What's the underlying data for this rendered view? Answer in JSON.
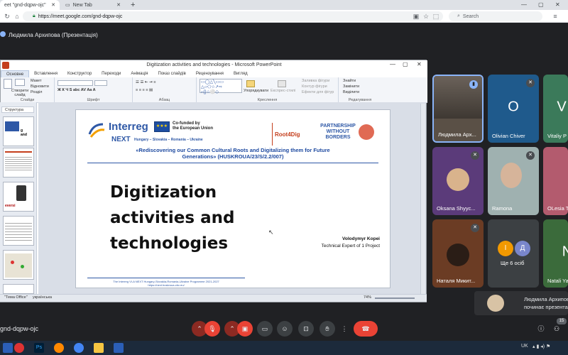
{
  "browser": {
    "tabs": [
      {
        "label": "eet \"gnd-dqpw-ojc\""
      },
      {
        "label": "New Tab"
      }
    ],
    "url": "https://meet.google.com/gnd-dqpw-ojc",
    "search_placeholder": "Search"
  },
  "meet": {
    "presenter_label": "Людмила Архипова (Презентація)",
    "meeting_code": "gnd-dqpw-ojc",
    "participant_count": "15"
  },
  "ppt": {
    "window_title": "Digitization activities and technologies  -  Microsoft PowerPoint",
    "ribbon_tabs": [
      "Основне",
      "Вставлення",
      "Конструктор",
      "Переходи",
      "Анімація",
      "Показ слайдів",
      "Рецензування",
      "Вигляд"
    ],
    "ribbon_groups": [
      "Слайди",
      "Шрифт",
      "Абзац",
      "Креслення",
      "Редагування"
    ],
    "ribbon_items": {
      "new_slide": "Створити слайд",
      "layout": "Макет",
      "reset": "Відновити",
      "section": "Розділ",
      "arrange": "Упорядкувати",
      "quick_styles": "Експрес-стилі",
      "shape_fill": "Заливка фігури",
      "shape_outline": "Контур фігури",
      "shape_effects": "Ефекти для фігур",
      "find": "Знайти",
      "replace": "Замінити",
      "select": "Виділити"
    },
    "outline_tab": "Структура",
    "status": {
      "theme": "\"Тема Office\"",
      "language": "українська",
      "zoom": "74%"
    }
  },
  "slide": {
    "logo_interreg": "Interreg",
    "logo_next": "NEXT",
    "countries": "Hungary – Slovakia – Romania – Ukraine",
    "cofunded": "Co-funded by",
    "cofunded2": "the European Union",
    "root4dig": "Root4Dig",
    "partnership": "PARTNERSHIP",
    "without": "WITHOUT",
    "borders": "BORDERS",
    "project_title_1": "«Rediscovering our Common Cultural Roots and Digitalizing them for Future",
    "project_title_2": "Generations» (HUSKROUA/23/S/2.2/007)",
    "title_1": "Digitization",
    "title_2": "activities and",
    "title_3": "technologies",
    "speaker_name": "Volodymyr Kopei",
    "speaker_role": "Technical Expert of 1 Project",
    "footer_1": "The Interreg VI-A NEXT Hungary-Slovakia-Romania-Ukraine Programme 2021-2027",
    "footer_2": "https://next.huskroua-cbc.eu/"
  },
  "participants": [
    {
      "name": "Людмила Арх...",
      "letter": ""
    },
    {
      "name": "Olivian Chiver",
      "letter": "O"
    },
    {
      "name": "Vitaliy P",
      "letter": "V"
    },
    {
      "name": "Oksana Shyyc...",
      "letter": ""
    },
    {
      "name": "Ramona",
      "letter": ""
    },
    {
      "name": "OLesia T",
      "letter": ""
    },
    {
      "name": "Наталя Микит...",
      "letter": ""
    },
    {
      "name": "Ще 6 осіб",
      "letter": ""
    },
    {
      "name": "Natali Ya",
      "letter": "N"
    }
  ],
  "more_avatars": [
    "І",
    "Д"
  ],
  "toast": {
    "line1": "Людмила Архипова",
    "line2": "починає презентаці"
  },
  "taskbar": {
    "lang": "UK"
  }
}
